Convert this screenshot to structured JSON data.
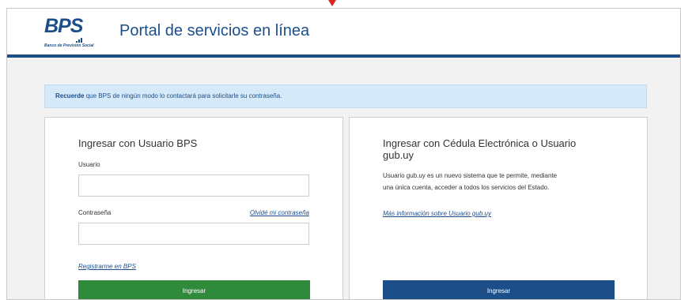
{
  "header": {
    "logo_text": "BPS",
    "logo_subtitle": "Banco de Previsión Social",
    "title": "Portal de servicios en línea"
  },
  "notice": {
    "emphasis": "Recuerde",
    "text": " que BPS de ningún modo lo contactará para solicitarle su contraseña."
  },
  "login_bps": {
    "title": "Ingresar con Usuario BPS",
    "user_label": "Usuario",
    "user_value": "",
    "password_label": "Contraseña",
    "password_value": "",
    "forgot_link": "Olvidé mi contraseña",
    "register_link": "Registrarme en BPS",
    "submit_label": "Ingresar"
  },
  "login_gubuy": {
    "title_line1": "Ingresar con Cédula Electrónica o Usuario",
    "title_line2": "gub.uy",
    "description_line1": "Usuario gub.uy es un nuevo sistema que te permite, mediante",
    "description_line2": "una única cuenta, acceder a todos los servicios del Estado.",
    "more_info_link": "Más información sobre Usuario gub.uy",
    "submit_label": "Ingresar"
  },
  "colors": {
    "brand_blue": "#1c4e8a",
    "login_green": "#2f8a3c",
    "notice_bg": "#d6e9f8",
    "marker_red": "#d7261e"
  }
}
